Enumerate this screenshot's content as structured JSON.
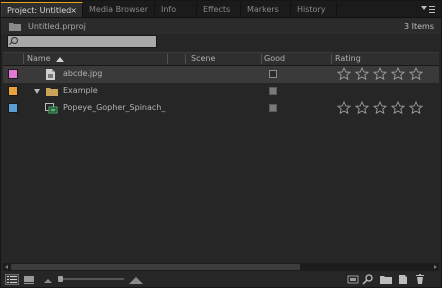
{
  "tabs": [
    {
      "label": "Project: Untitled",
      "active": true,
      "close": "×"
    },
    {
      "label": "Media Browser",
      "active": false
    },
    {
      "label": "Info",
      "active": false
    },
    {
      "label": "Effects",
      "active": false
    },
    {
      "label": "Markers",
      "active": false
    },
    {
      "label": "History",
      "active": false
    }
  ],
  "project": {
    "file_name": "Untitled.prproj",
    "item_count": "3 Items"
  },
  "search": {
    "value": "",
    "placeholder": ""
  },
  "columns": {
    "name": "Name",
    "scene": "Scene",
    "good": "Good",
    "rating": "Rating"
  },
  "rows": [
    {
      "name": "abcde.jpg",
      "label_color": "#e07ad6",
      "type": "image",
      "good": "checkbox",
      "rating": 0,
      "stars": 5
    },
    {
      "name": "Example",
      "label_color": "#e8a33a",
      "type": "bin",
      "expanded": true,
      "good": "filled"
    },
    {
      "name": "Popeye_Gopher_Spinach_",
      "label_color": "#5a9fd4",
      "type": "sequence",
      "good": "filled",
      "rating": 0,
      "stars": 5
    }
  ],
  "colors": {
    "active_tab_accent": "#e8a317",
    "panel_bg": "#262626"
  },
  "icons": {
    "panel_menu": "panel-menu-icon",
    "list_view": "list-view-icon",
    "icon_view": "icon-view-icon",
    "zoom_small": "zoom-out-mountain-icon",
    "zoom_large": "zoom-in-mountain-icon",
    "automate": "automate-to-sequence-icon",
    "find": "find-icon",
    "new_bin": "new-bin-icon",
    "new_item": "new-item-icon",
    "clear": "trash-icon"
  }
}
